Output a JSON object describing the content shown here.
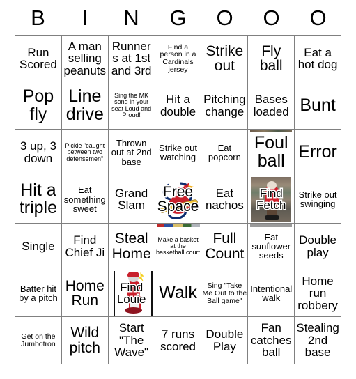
{
  "card": {
    "title": "BINGOOO Baseball Bingo Card",
    "header_letters": [
      "B",
      "I",
      "N",
      "G",
      "O",
      "O",
      "O"
    ],
    "columns": 7,
    "rows": 7,
    "grid_line_color": "#808080",
    "background_color": "#ffffff",
    "text_color": "#000000",
    "rows_data": [
      [
        {
          "text": "Run Scored",
          "size": "md",
          "image": null
        },
        {
          "text": "A man selling peanuts",
          "size": "md",
          "image": null
        },
        {
          "text": "Runners at 1st and 3rd",
          "size": "md",
          "image": null
        },
        {
          "text": "Find a person in a Cardinals jersey",
          "size": "xs",
          "image": null
        },
        {
          "text": "Strike out",
          "size": "lg",
          "image": null
        },
        {
          "text": "Fly ball",
          "size": "lg",
          "image": null
        },
        {
          "text": "Eat a hot dog",
          "size": "md",
          "image": null
        }
      ],
      [
        {
          "text": "Pop fly",
          "size": "xl",
          "image": null
        },
        {
          "text": "Line drive",
          "size": "xl",
          "image": null
        },
        {
          "text": "Sing the MK song in your seat Loud and Proud!",
          "size": "xxs",
          "image": null
        },
        {
          "text": "Hit a double",
          "size": "md",
          "image": null
        },
        {
          "text": "Pitching change",
          "size": "md",
          "image": null
        },
        {
          "text": "Bases loaded",
          "size": "md",
          "image": null
        },
        {
          "text": "Bunt",
          "size": "xl",
          "image": null
        }
      ],
      [
        {
          "text": "3 up, 3 down",
          "size": "md",
          "image": null
        },
        {
          "text": "Pickle \"caught between two defensemen\"",
          "size": "xxs",
          "image": null
        },
        {
          "text": "Thrown out at 2nd base",
          "size": "sm",
          "image": null
        },
        {
          "text": "Strike out watching",
          "size": "sm",
          "image": null
        },
        {
          "text": "Eat popcorn",
          "size": "sm",
          "image": null
        },
        {
          "text": "Foul ball",
          "size": "xl",
          "image": "crowd-photo"
        },
        {
          "text": "Error",
          "size": "xl",
          "image": null
        }
      ],
      [
        {
          "text": "Hit a triple",
          "size": "xl",
          "image": null
        },
        {
          "text": "Eat something sweet",
          "size": "sm",
          "image": null
        },
        {
          "text": "Grand Slam",
          "size": "md",
          "image": null
        },
        {
          "text": "Free Space",
          "size": "lg",
          "image": "cardinals-logo",
          "outlined": true
        },
        {
          "text": "Eat nachos",
          "size": "md",
          "image": null
        },
        {
          "text": "Find Fetch",
          "size": "md",
          "image": "fetch-mascot-photo",
          "outlined": true
        },
        {
          "text": "Strike out swinging",
          "size": "sm",
          "image": null
        }
      ],
      [
        {
          "text": "Single",
          "size": "md",
          "image": null
        },
        {
          "text": "Find Chief Ji",
          "size": "md",
          "image": null
        },
        {
          "text": "Steal Home",
          "size": "lg",
          "image": null
        },
        {
          "text": "Make a basket at the basketball court",
          "size": "xxs",
          "image": "basketball-court-photo"
        },
        {
          "text": "Full Count",
          "size": "lg",
          "image": null
        },
        {
          "text": "Eat sunflower seeds",
          "size": "sm",
          "image": "grey-photo"
        },
        {
          "text": "Double play",
          "size": "md",
          "image": null
        }
      ],
      [
        {
          "text": "Batter hit by a pitch",
          "size": "sm",
          "image": null
        },
        {
          "text": "Home Run",
          "size": "lg",
          "image": null
        },
        {
          "text": "Find Louie",
          "size": "md",
          "image": "louie-mascot-photo",
          "outlined": true
        },
        {
          "text": "Walk",
          "size": "xl",
          "image": null
        },
        {
          "text": "Sing \"Take Me Out to the Ball game\"",
          "size": "xs",
          "image": null
        },
        {
          "text": "Intentional walk",
          "size": "sm",
          "image": null
        },
        {
          "text": "Home run robbery",
          "size": "md",
          "image": null
        }
      ],
      [
        {
          "text": "Get on the Jumbotron",
          "size": "xs",
          "image": null
        },
        {
          "text": "Wild pitch",
          "size": "lg",
          "image": null
        },
        {
          "text": "Start \"The Wave\"",
          "size": "md",
          "image": null
        },
        {
          "text": "7 runs scored",
          "size": "md",
          "image": null
        },
        {
          "text": "Double Play",
          "size": "md",
          "image": null
        },
        {
          "text": "Fan catches ball",
          "size": "md",
          "image": null
        },
        {
          "text": "Stealing 2nd base",
          "size": "md",
          "image": null
        }
      ]
    ]
  },
  "logo_colors": {
    "cardinal_red": "#c8202c",
    "bat_yellow": "#f2c43a",
    "stl_blue": "#0c2c6e",
    "mascot_red": "#d0202c"
  }
}
